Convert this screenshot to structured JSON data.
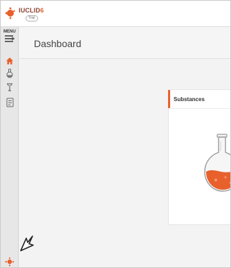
{
  "app": {
    "logo_text": "IUCLID",
    "logo_version": "6",
    "logo_subtitle": "Trial"
  },
  "sidebar": {
    "menu_label": "MENU",
    "items": [
      {
        "name": "home",
        "icon": "home-icon",
        "active": true
      },
      {
        "name": "substances",
        "icon": "flask-icon",
        "active": false
      },
      {
        "name": "mixtures",
        "icon": "mixture-icon",
        "active": false
      },
      {
        "name": "documents",
        "icon": "document-icon",
        "active": false
      }
    ]
  },
  "main": {
    "page_title": "Dashboard",
    "card": {
      "title": "Substances",
      "icon": "flask-icon"
    }
  },
  "colors": {
    "accent": "#e8602c",
    "brand": "#8a3e2c"
  }
}
